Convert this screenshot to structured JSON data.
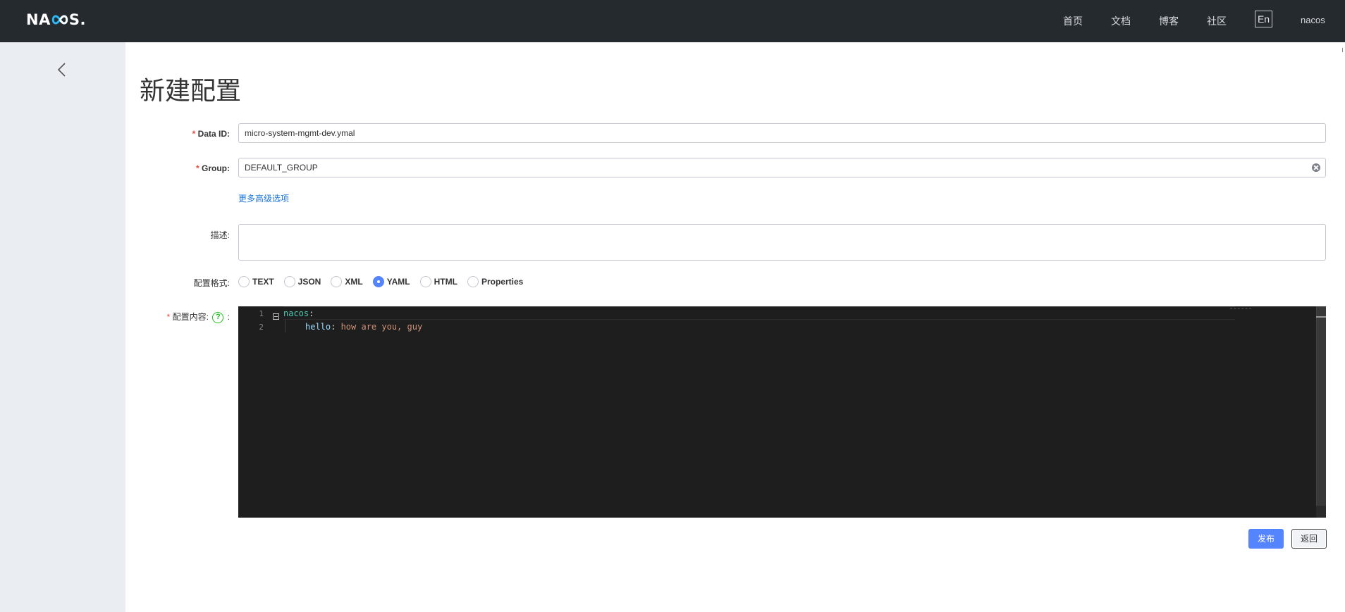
{
  "header": {
    "logo_text": "NACOS.",
    "nav": [
      "首页",
      "文档",
      "博客",
      "社区"
    ],
    "lang": "En",
    "user": "nacos"
  },
  "page": {
    "title": "新建配置"
  },
  "form": {
    "data_id": {
      "label": "Data ID:",
      "value": "micro-system-mgmt-dev.ymal"
    },
    "group": {
      "label": "Group:",
      "value": "DEFAULT_GROUP"
    },
    "advanced_link": "更多高级选项",
    "description": {
      "label": "描述:",
      "value": ""
    },
    "format": {
      "label": "配置格式:",
      "options": [
        "TEXT",
        "JSON",
        "XML",
        "YAML",
        "HTML",
        "Properties"
      ],
      "selected": "YAML"
    },
    "content": {
      "label": "配置内容:",
      "help": "?",
      "suffix": ":",
      "lines": [
        {
          "num": "1",
          "key": "nacos",
          "colon": ":",
          "value": ""
        },
        {
          "num": "2",
          "key": "hello",
          "colon": ":",
          "value": " how are you, guy"
        }
      ]
    }
  },
  "actions": {
    "publish": "发布",
    "back": "返回"
  },
  "colors": {
    "topbar": "#252a2f",
    "sidebar": "#eaedf1",
    "primary": "#5584ff",
    "required": "#e64a3b",
    "link": "#2077d7",
    "editor_bg": "#1e1e1e"
  }
}
